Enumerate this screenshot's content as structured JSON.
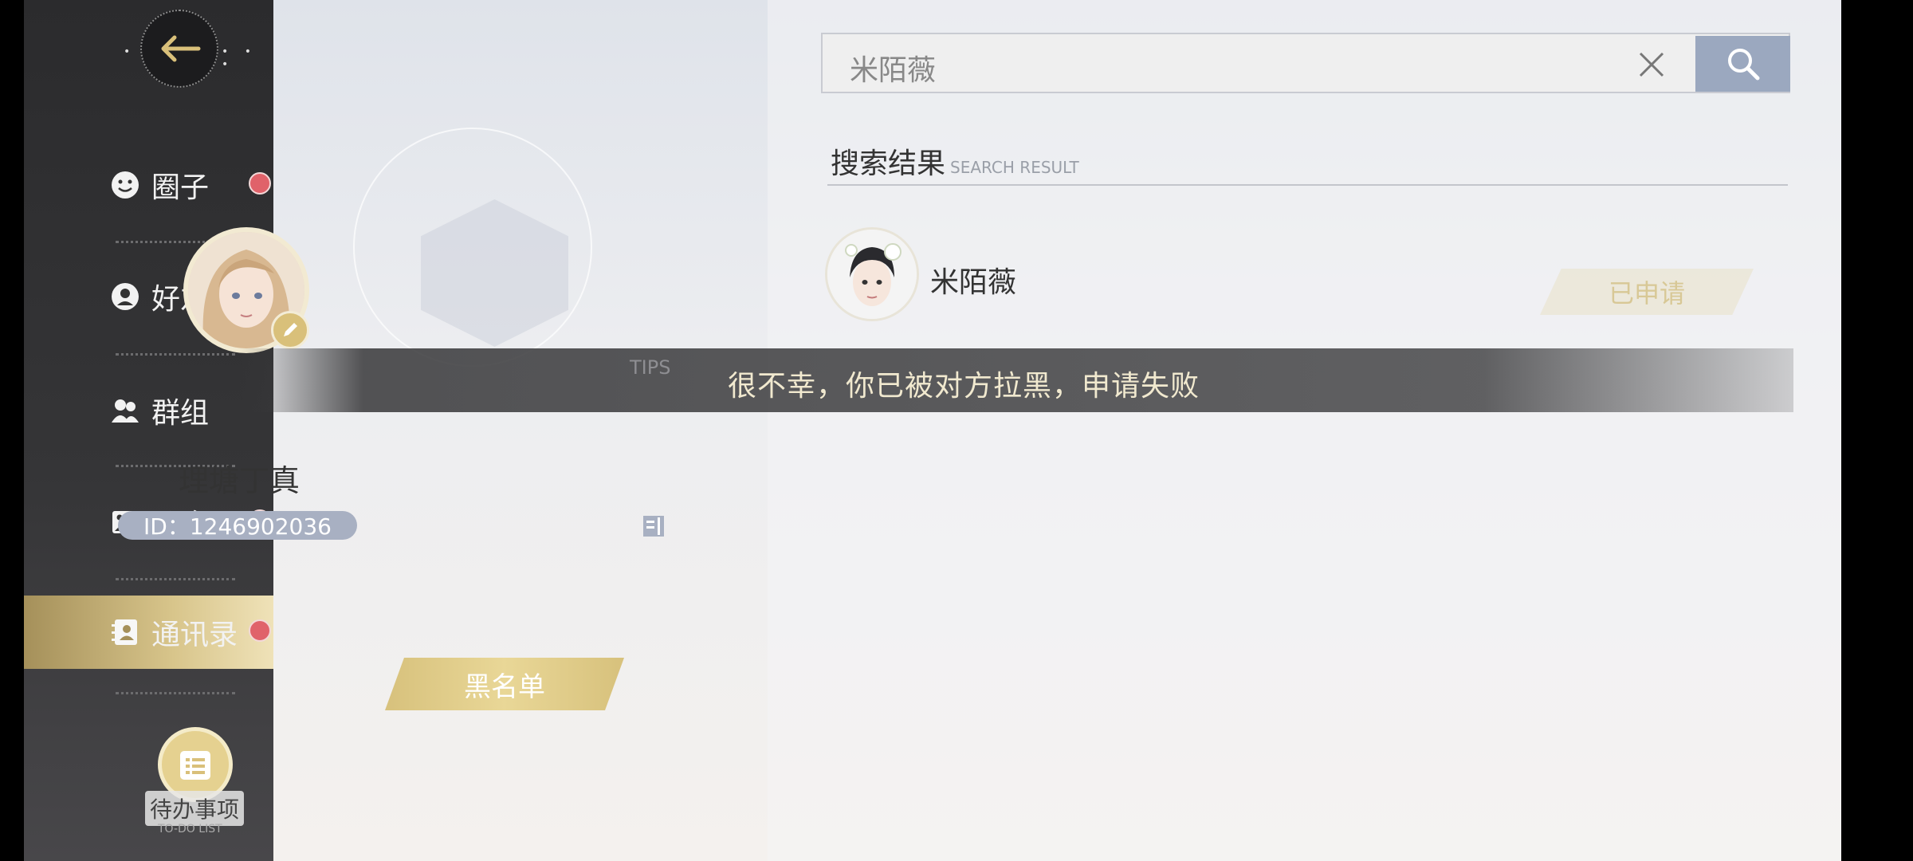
{
  "sidebar": {
    "items": [
      {
        "label": "圈子",
        "icon": "smile-icon",
        "badge": ""
      },
      {
        "label": "好友",
        "icon": "friend-icon",
        "badge": ""
      },
      {
        "label": "群组",
        "icon": "group-icon",
        "badge": ""
      },
      {
        "label": "公众号",
        "icon": "image-icon",
        "badge": "!"
      },
      {
        "label": "通讯录",
        "icon": "contacts-icon",
        "badge": ""
      }
    ],
    "todo": {
      "label": "待办事项",
      "sub": "TO-DO LIST"
    }
  },
  "profile": {
    "name": "理塘丁真",
    "id_text": "ID：1246902036",
    "blacklist_label": "黑名单"
  },
  "search": {
    "value": "米陌薇"
  },
  "results": {
    "title": "搜索结果",
    "subtitle": "SEARCH RESULT",
    "items": [
      {
        "name": "米陌薇",
        "status": "已申请"
      }
    ]
  },
  "toast": {
    "tips": "TIPS",
    "message": "很不幸，你已被对方拉黑，申请失败"
  },
  "colors": {
    "accent_gold": "#d7c17c",
    "badge_red": "#e0626a",
    "search_button": "#9ba8bf"
  }
}
